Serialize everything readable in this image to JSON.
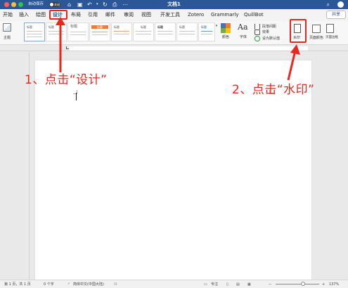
{
  "titlebar": {
    "autosave_label": "自动保存",
    "autosave_state": "关闭",
    "title": "文档1"
  },
  "menu": {
    "tabs": [
      {
        "label": "开始"
      },
      {
        "label": "插入"
      },
      {
        "label": "绘图"
      },
      {
        "label": "设计",
        "active": true
      },
      {
        "label": "布局"
      },
      {
        "label": "引用"
      },
      {
        "label": "邮件"
      },
      {
        "label": "审阅"
      },
      {
        "label": "视图"
      },
      {
        "label": "开发工具"
      },
      {
        "label": "Zotero"
      },
      {
        "label": "Grammarly"
      },
      {
        "label": "QuillBot"
      }
    ],
    "share_label": "共享"
  },
  "ribbon": {
    "theme_label": "主题",
    "style_thumbs": [
      "标题",
      "标题",
      "标题",
      "标题",
      "标题",
      "标题",
      "标题",
      "标题",
      "标题"
    ],
    "colors_label": "颜色",
    "fonts_label": "字体",
    "paragraph_spacing_label": "段落间距",
    "effects_label": "效果",
    "set_default_label": "设为默认值",
    "watermark_label": "水印",
    "page_color_label": "页面颜色",
    "page_borders_label": "页面边框"
  },
  "annotations": {
    "step1": "1、点击“设计”",
    "step2": "2、点击“水印”",
    "color": "#e8281e"
  },
  "statusbar": {
    "page_info": "第 1 页，共 1 页",
    "word_count": "0 个字",
    "language": "简体中文(中国大陆)",
    "focus_label": "专注",
    "zoom": "137%"
  },
  "colors": {
    "titlebar": "#2b5797",
    "accent": "#2b5797",
    "highlight": "#e8281e"
  }
}
